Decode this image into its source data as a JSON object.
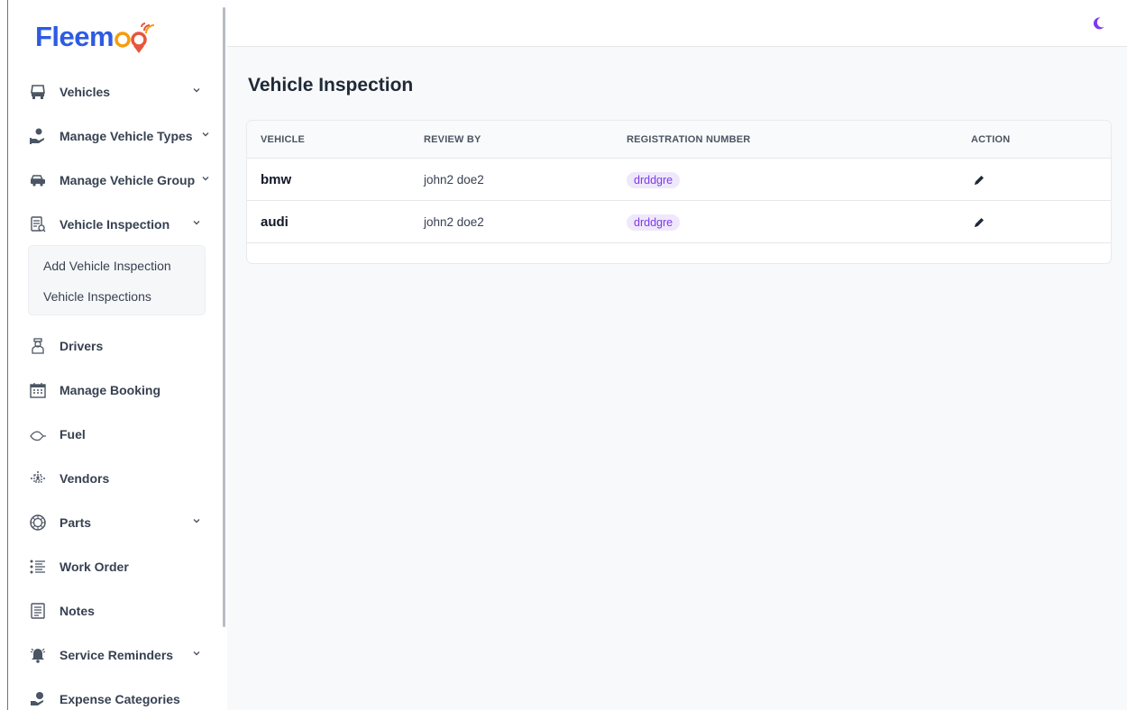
{
  "brand": {
    "name_part1": "Fleem",
    "name_part2": "o",
    "name_part3": "o",
    "color": "#2d5be3",
    "accent": "#f59e0b"
  },
  "sidebar": {
    "items": [
      {
        "label": "Vehicles",
        "icon": "vehicle-icon",
        "has_chevron": true
      },
      {
        "label": "Manage Vehicle Types",
        "icon": "vehicle-types-icon",
        "has_chevron": true
      },
      {
        "label": "Manage Vehicle Group",
        "icon": "vehicle-group-icon",
        "has_chevron": true
      },
      {
        "label": "Vehicle Inspection",
        "icon": "inspection-icon",
        "has_chevron": true,
        "expanded": true
      },
      {
        "label": "Drivers",
        "icon": "driver-icon",
        "has_chevron": false
      },
      {
        "label": "Manage Booking",
        "icon": "calendar-icon",
        "has_chevron": false
      },
      {
        "label": "Fuel",
        "icon": "fuel-icon",
        "has_chevron": false
      },
      {
        "label": "Vendors",
        "icon": "vendors-icon",
        "has_chevron": false
      },
      {
        "label": "Parts",
        "icon": "parts-icon",
        "has_chevron": true
      },
      {
        "label": "Work Order",
        "icon": "work-order-icon",
        "has_chevron": false
      },
      {
        "label": "Notes",
        "icon": "notes-icon",
        "has_chevron": false
      },
      {
        "label": "Service Reminders",
        "icon": "bell-icon",
        "has_chevron": true
      },
      {
        "label": "Expense Categories",
        "icon": "expense-icon",
        "has_chevron": false
      }
    ],
    "submenu": [
      {
        "label": "Add Vehicle Inspection"
      },
      {
        "label": "Vehicle Inspections"
      }
    ]
  },
  "topbar": {
    "theme_toggle_icon": "moon-icon",
    "accent_color": "#7c3aed"
  },
  "page": {
    "title": "Vehicle Inspection"
  },
  "table": {
    "columns": [
      "VEHICLE",
      "REVIEW BY",
      "REGISTRATION NUMBER",
      "ACTION"
    ],
    "rows": [
      {
        "vehicle": "bmw",
        "review_by": "john2 doe2",
        "registration": "drddgre",
        "action_icon": "edit-icon"
      },
      {
        "vehicle": "audi",
        "review_by": "john2 doe2",
        "registration": "drddgre",
        "action_icon": "edit-icon"
      }
    ]
  }
}
